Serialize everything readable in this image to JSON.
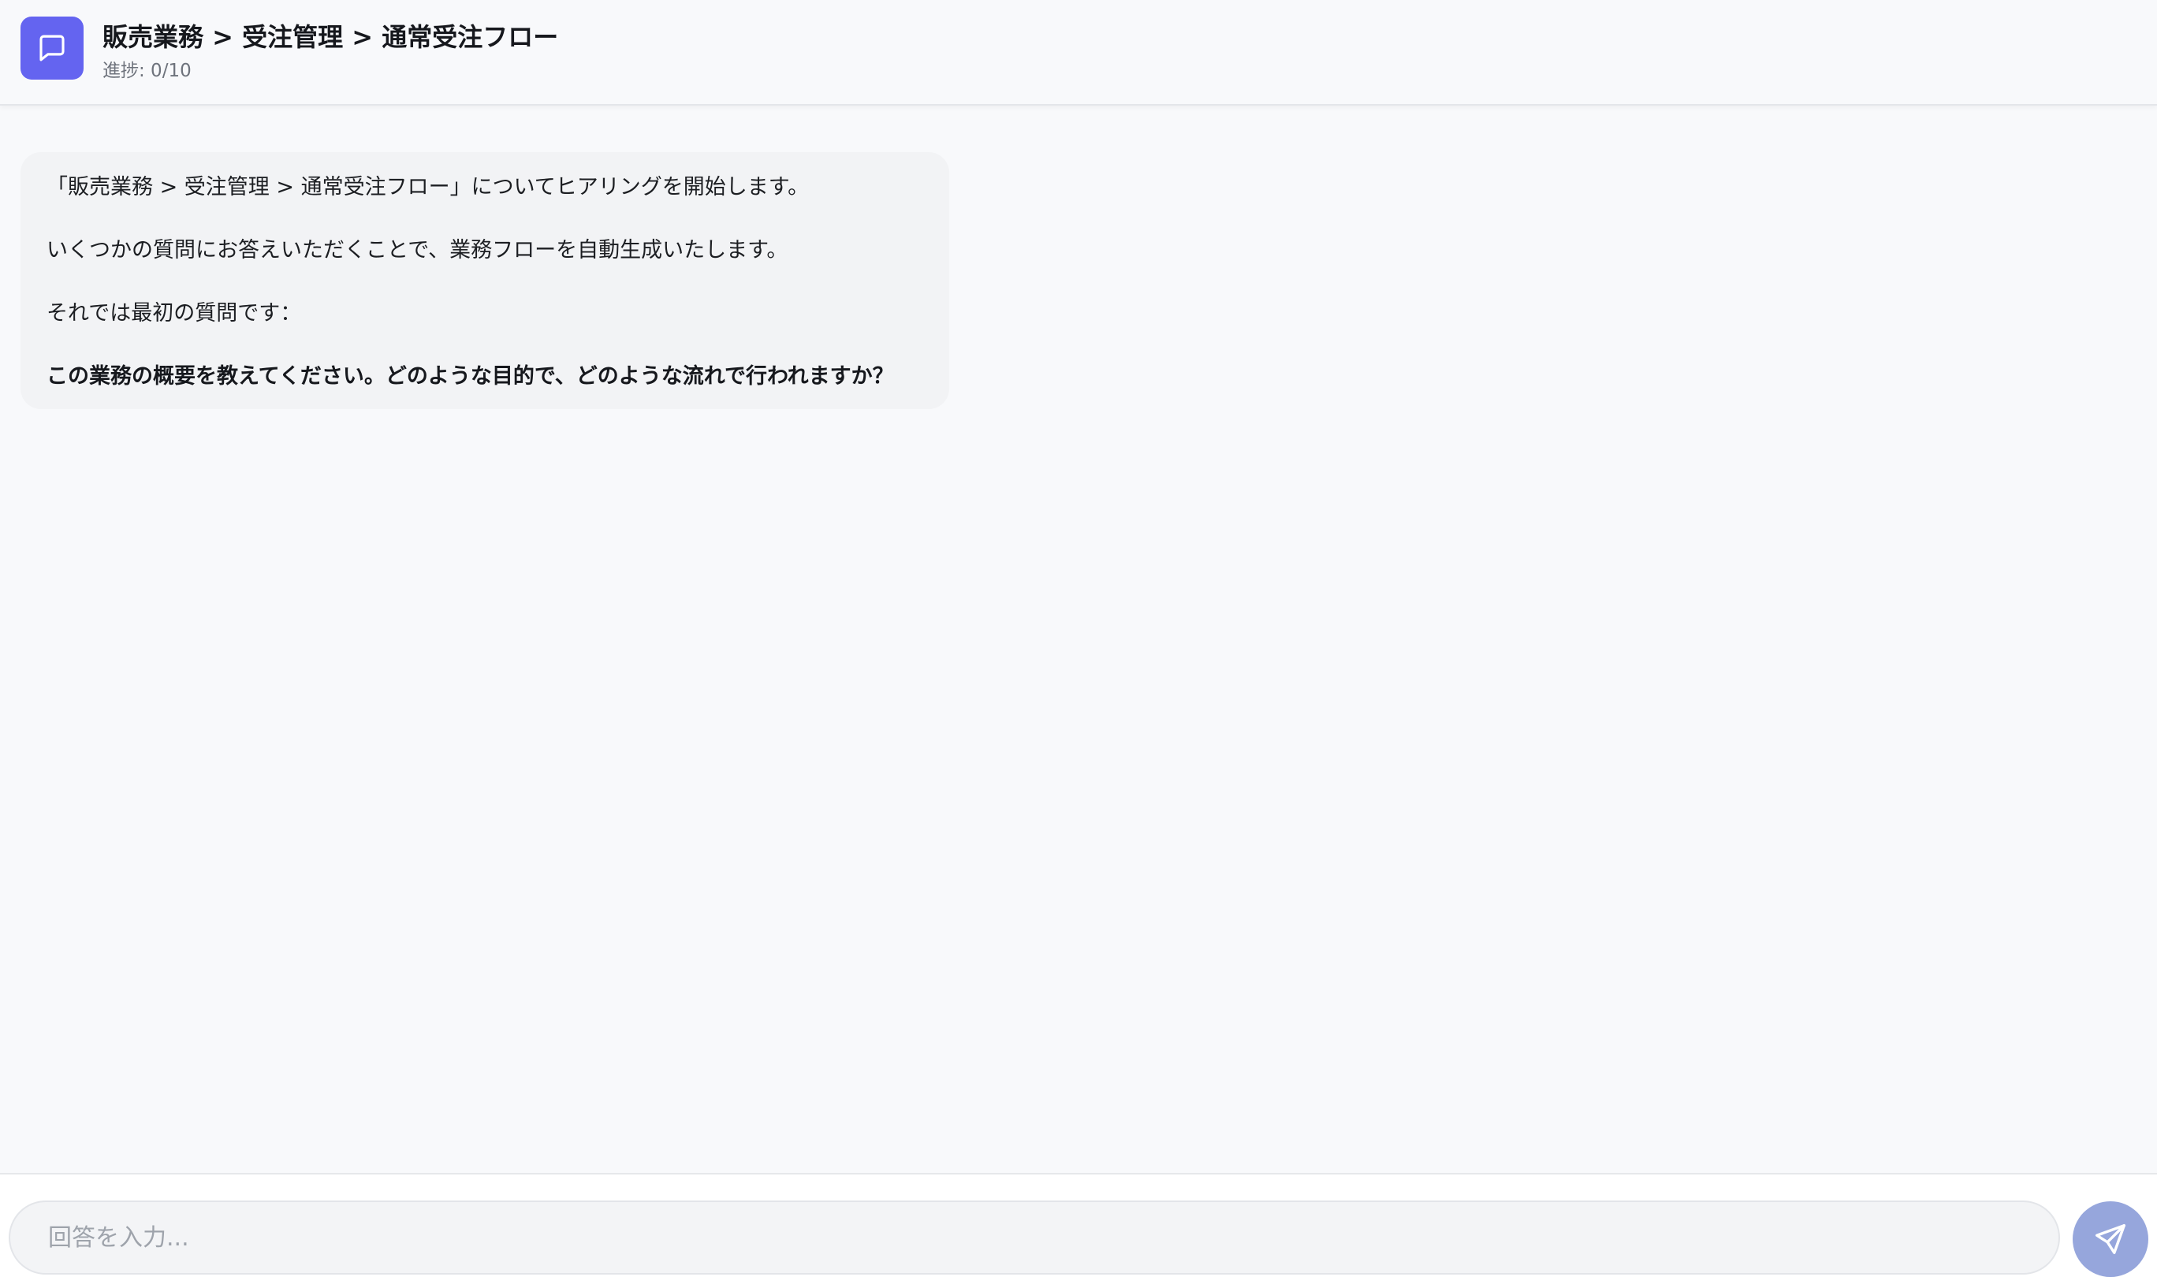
{
  "header": {
    "icon": "chat-bubble-icon",
    "title": "販売業務 > 受注管理 > 通常受注フロー",
    "progress": "進捗: 0/10",
    "accent_color": "#6464f0"
  },
  "messages": [
    {
      "role": "assistant",
      "lines": [
        "「販売業務 > 受注管理 > 通常受注フロー」についてヒアリングを開始します。",
        "いくつかの質問にお答えいただくことで、業務フローを自動生成いたします。",
        "それでは最初の質問です：",
        "この業務の概要を教えてください。どのような目的で、どのような流れで行われますか？"
      ]
    }
  ],
  "input": {
    "value": "",
    "placeholder": "回答を入力..."
  },
  "send_button": {
    "icon": "send-icon",
    "color": "#96a6dc"
  }
}
